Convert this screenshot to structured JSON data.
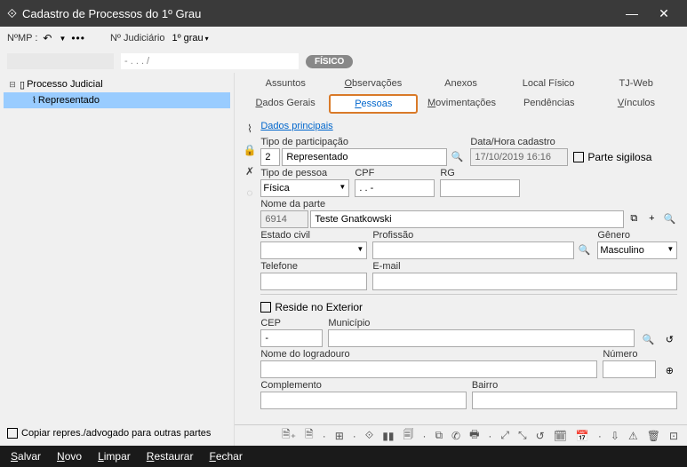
{
  "window": {
    "title": "Cadastro de Processos do 1º Grau"
  },
  "header": {
    "mp_label": "NºMP :",
    "judiciario_label": "Nº Judiciário",
    "grau_label": "1º grau"
  },
  "row2": {
    "mp_value": "",
    "proc_template": "- . . . /",
    "badge": "FÍSICO"
  },
  "tree": {
    "root": "Processo Judicial",
    "child1": "Representado"
  },
  "sidebar_checkbox": "Copiar repres./advogado para outras partes",
  "tabs": {
    "assuntos": "Assuntos",
    "observacoes_pre": "O",
    "observacoes_rest": "bservações",
    "anexos": "Anexos",
    "local": "Local Físico",
    "tjweb": "TJ-Web",
    "dados_pre": "D",
    "dados_rest": "ados Gerais",
    "pessoas_pre": "P",
    "pessoas_rest": "essoas",
    "mov_pre": "M",
    "mov_rest": "ovimentações",
    "pend": "Pendências",
    "vinc_pre": "V",
    "vinc_rest": "ínculos"
  },
  "form": {
    "dados_principais": "Dados principais",
    "tipo_participacao_label": "Tipo de participação",
    "tipo_participacao_num": "2",
    "tipo_participacao_txt": "Representado",
    "datahora_label": "Data/Hora cadastro",
    "datahora_val": "17/10/2019 16:16",
    "parte_sigilosa": "Parte sigilosa",
    "tipo_pessoa_label": "Tipo de pessoa",
    "tipo_pessoa_val": "Física",
    "cpf_label": "CPF",
    "cpf_val": ". . -",
    "rg_label": "RG",
    "nome_parte_label": "Nome da parte",
    "nome_parte_id": "6914",
    "nome_parte_val": "Teste Gnatkowski",
    "estado_civil_label": "Estado civil",
    "profissao_label": "Profissão",
    "genero_label": "Gênero",
    "genero_val": "Masculino",
    "telefone_label": "Telefone",
    "email_label": "E-mail",
    "reside_exterior": "Reside no Exterior",
    "cep_label": "CEP",
    "cep_val": "-",
    "municipio_label": "Município",
    "logradouro_label": "Nome do logradouro",
    "numero_label": "Número",
    "complemento_label": "Complemento",
    "bairro_label": "Bairro"
  },
  "footer": {
    "salvar_pre": "S",
    "salvar_rest": "alvar",
    "novo_pre": "N",
    "novo_rest": "ovo",
    "limpar_pre": "L",
    "limpar_rest": "impar",
    "restaurar_pre": "R",
    "restaurar_rest": "estaurar",
    "fechar_pre": "F",
    "fechar_rest": "echar"
  }
}
